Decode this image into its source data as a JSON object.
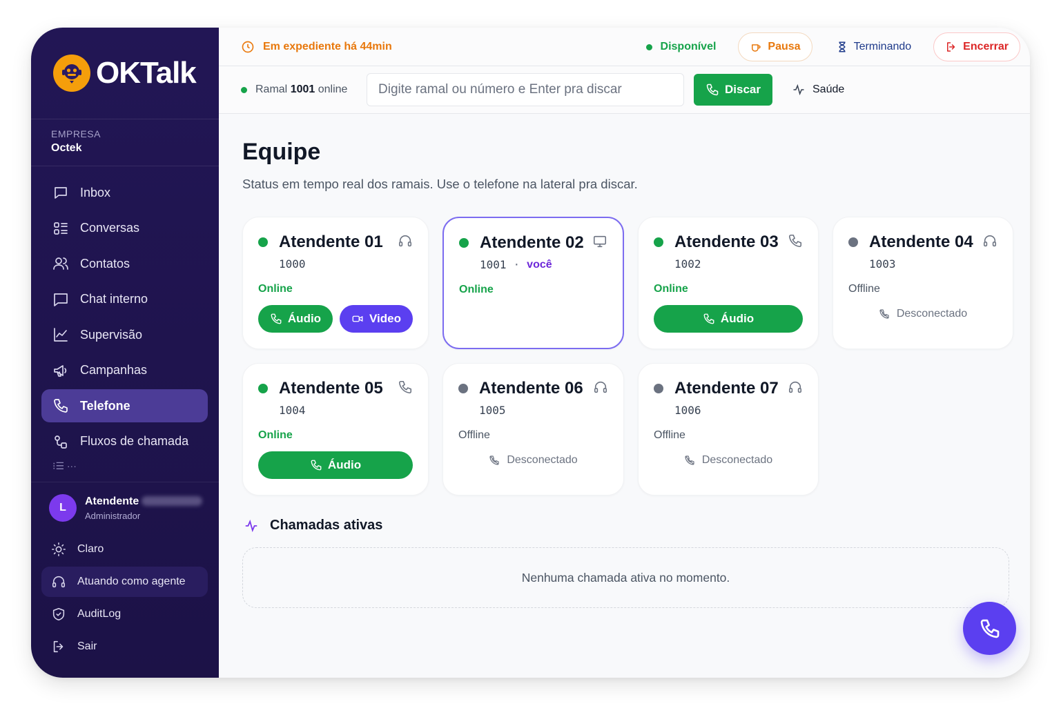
{
  "brand": {
    "name": "OKTalk"
  },
  "company": {
    "label": "EMPRESA",
    "name": "Octek"
  },
  "sidebar": {
    "items": [
      {
        "label": "Inbox",
        "icon": "inbox-icon"
      },
      {
        "label": "Conversas",
        "icon": "conversations-icon"
      },
      {
        "label": "Contatos",
        "icon": "contacts-icon"
      },
      {
        "label": "Chat interno",
        "icon": "chat-icon"
      },
      {
        "label": "Supervisão",
        "icon": "chart-line-icon"
      },
      {
        "label": "Campanhas",
        "icon": "megaphone-icon"
      },
      {
        "label": "Telefone",
        "icon": "phone-icon",
        "active": true
      },
      {
        "label": "Fluxos de chamada",
        "icon": "flow-icon"
      }
    ]
  },
  "user": {
    "initial": "L",
    "name": "Atendente",
    "role": "Administrador"
  },
  "bottom_menu": {
    "theme": "Claro",
    "agent_mode": "Atuando como agente",
    "auditlog": "AuditLog",
    "logout": "Sair"
  },
  "topbar": {
    "shift": "Em expediente há 44min",
    "status": "Disponível",
    "pause": "Pausa",
    "finishing": "Terminando",
    "end": "Encerrar"
  },
  "dialbar": {
    "ramal_label": "Ramal",
    "ramal_number": "1001",
    "ramal_status": "online",
    "placeholder": "Digite ramal ou número e Enter pra discar",
    "dial_button": "Discar",
    "health": "Saúde"
  },
  "page": {
    "title": "Equipe",
    "subtitle": "Status em tempo real dos ramais. Use o telefone na lateral pra discar."
  },
  "agents": [
    {
      "name": "Atendente 01",
      "ext": "1000",
      "status": "Online",
      "audio": "Áudio",
      "video": "Video",
      "device": "headset-icon"
    },
    {
      "name": "Atendente 02",
      "ext": "1001",
      "you": "você",
      "status": "Online",
      "device": "monitor-icon"
    },
    {
      "name": "Atendente 03",
      "ext": "1002",
      "status": "Online",
      "audio": "Áudio",
      "device": "phone-icon"
    },
    {
      "name": "Atendente 04",
      "ext": "1003",
      "status": "Offline",
      "disconnected": "Desconectado",
      "device": "headset-icon"
    },
    {
      "name": "Atendente 05",
      "ext": "1004",
      "status": "Online",
      "audio": "Áudio",
      "device": "phone-icon"
    },
    {
      "name": "Atendente 06",
      "ext": "1005",
      "status": "Offline",
      "disconnected": "Desconectado",
      "device": "headset-icon"
    },
    {
      "name": "Atendente 07",
      "ext": "1006",
      "status": "Offline",
      "disconnected": "Desconectado",
      "device": "headset-icon"
    }
  ],
  "active_calls": {
    "title": "Chamadas ativas",
    "empty": "Nenhuma chamada ativa no momento."
  },
  "colors": {
    "primary": "#5b3ff0",
    "success": "#16a34a",
    "warning": "#e8780c",
    "danger": "#dc2626",
    "sidebar": "#1f1452"
  }
}
